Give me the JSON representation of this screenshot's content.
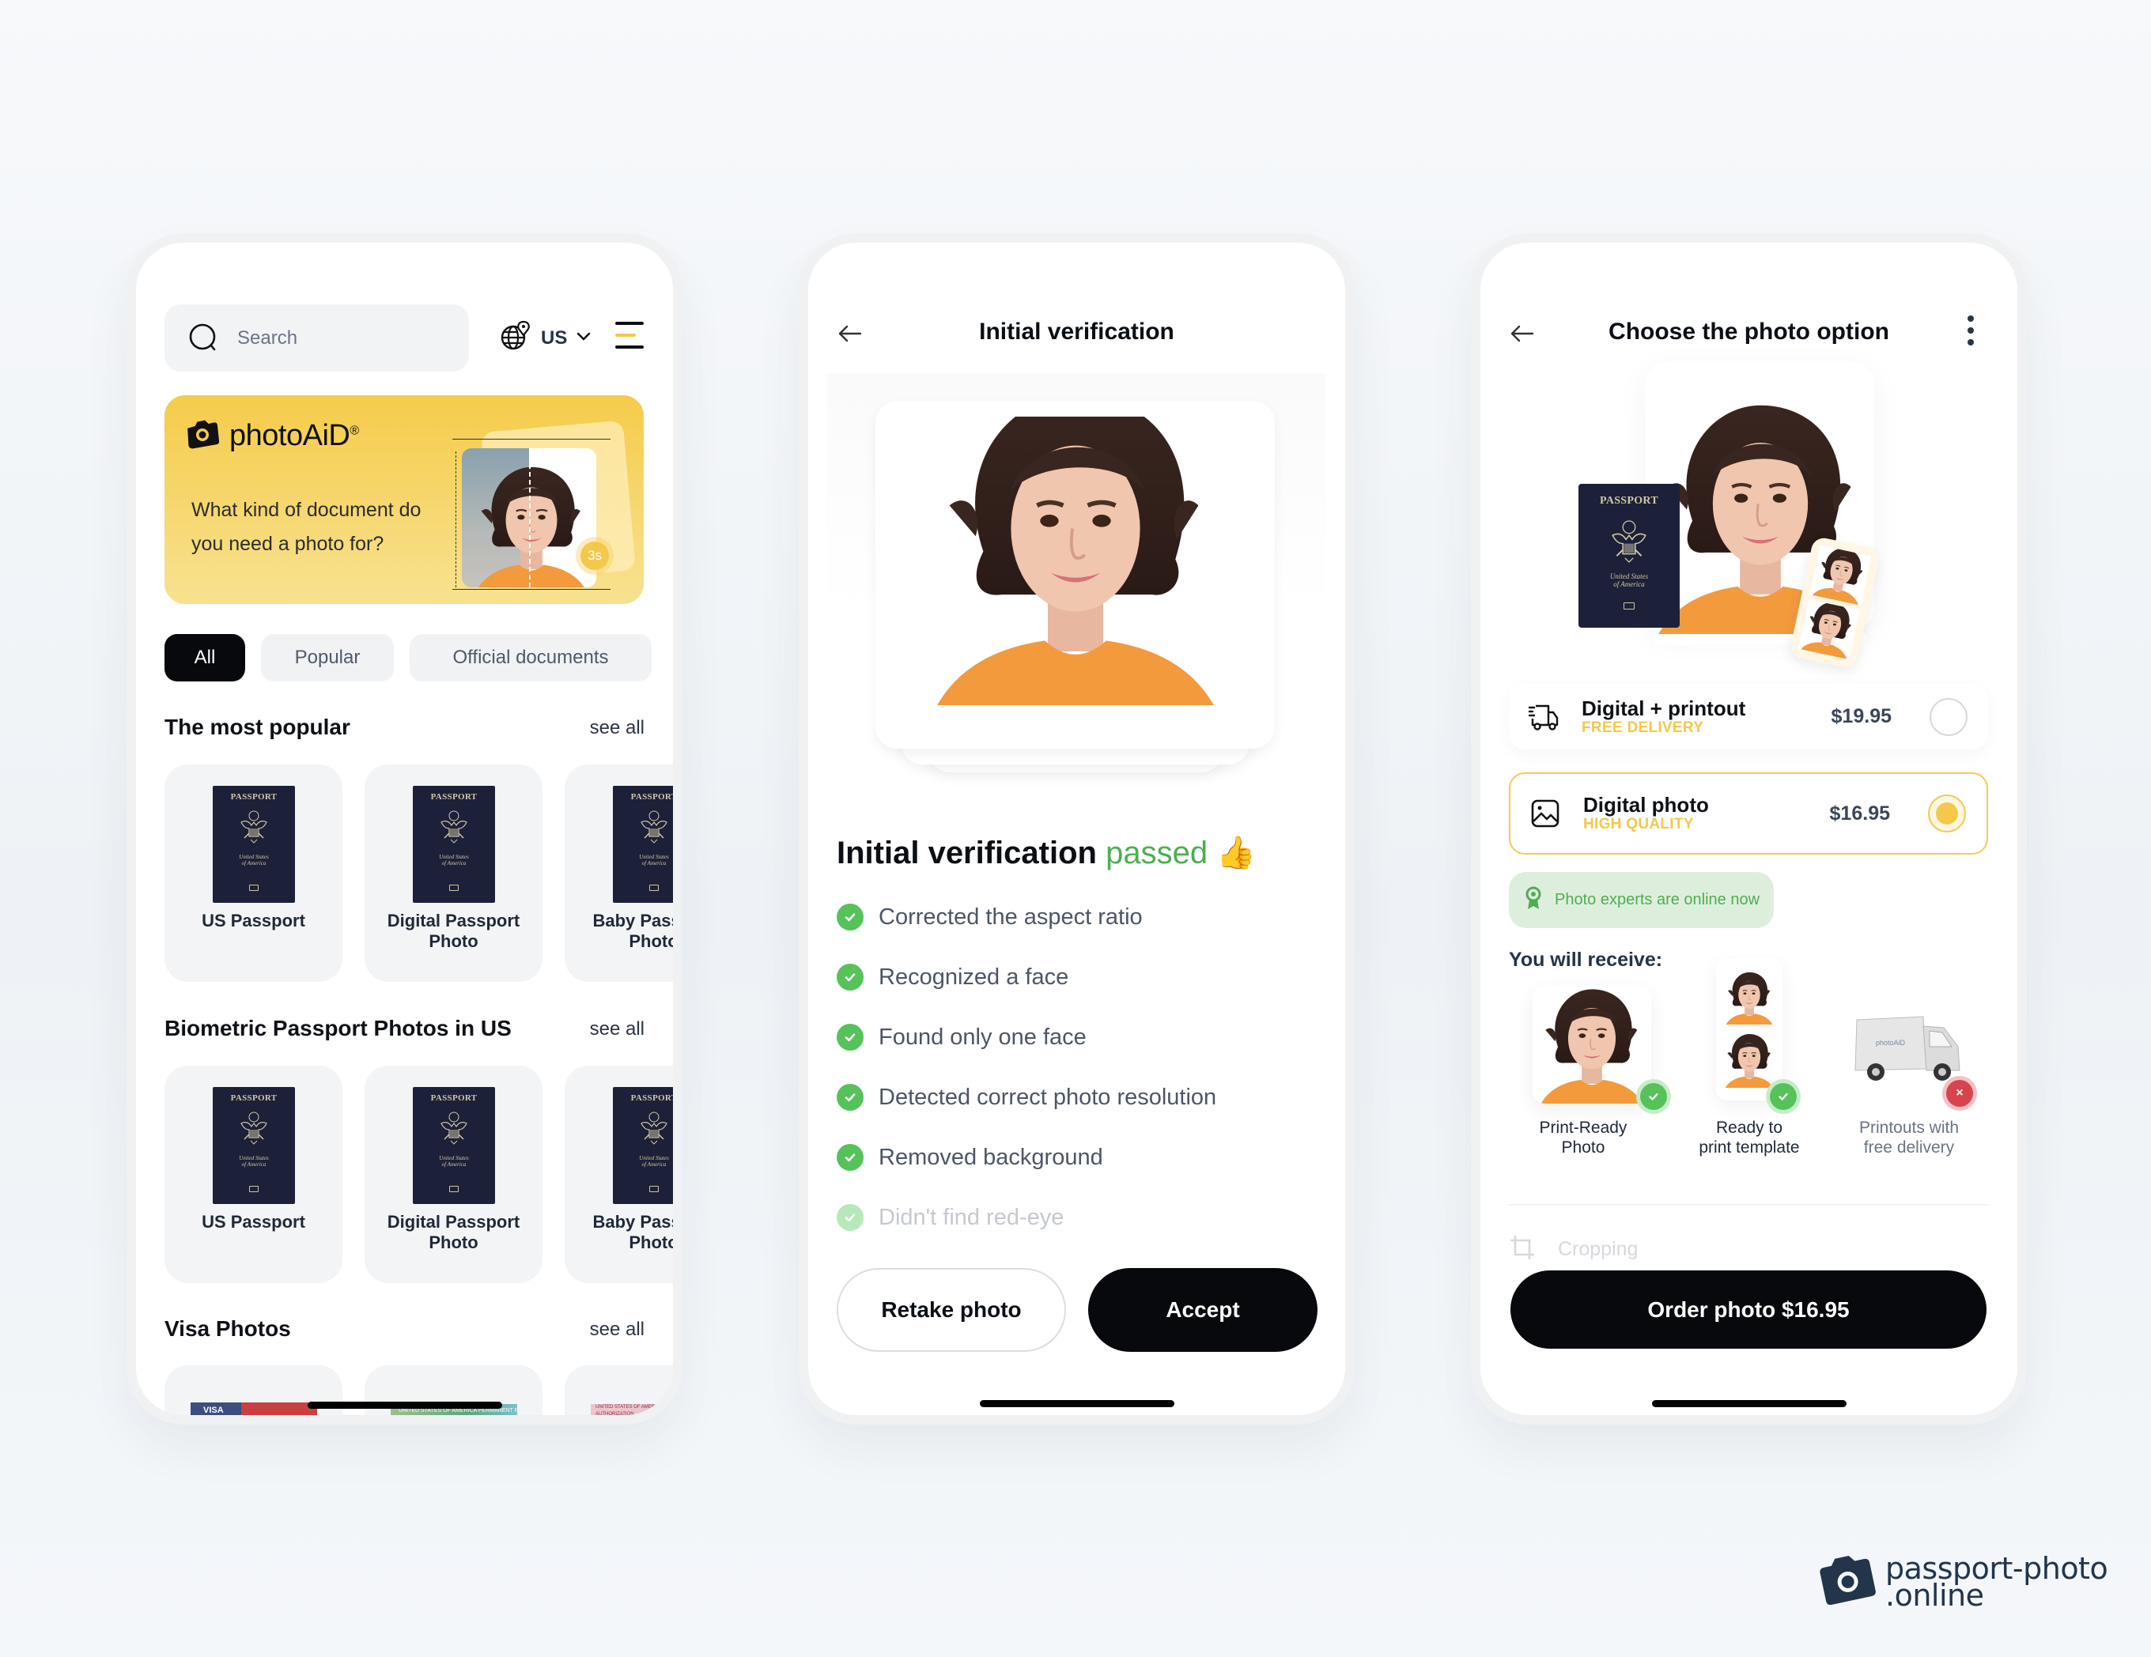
{
  "colors": {
    "accent_yellow": "#f4c84a",
    "success_green": "#4caf50",
    "check_green": "#56c25a",
    "error_red": "#d7444e",
    "primary_dark": "#07090c",
    "brand_navy": "#22354a"
  },
  "home_screen": {
    "search": {
      "placeholder": "Search",
      "value": ""
    },
    "locale": {
      "icon": "globe-pin-icon",
      "label": "US",
      "chevron": "chevron-down-icon"
    },
    "menu": {
      "icon": "hamburger-menu-icon"
    },
    "banner": {
      "brand": "photoAiD",
      "brand_mark": "®",
      "prompt": "What kind of document do you need a photo for?",
      "timer_badge": "3s"
    },
    "filter_chips": [
      {
        "label": "All",
        "active": true
      },
      {
        "label": "Popular",
        "active": false
      },
      {
        "label": "Official documents",
        "active": false
      }
    ],
    "sections": [
      {
        "title": "The most popular",
        "see_all": "see all",
        "cards": [
          {
            "name": "US Passport",
            "image": "us-passport-cover"
          },
          {
            "name": "Digital Passport Photo",
            "image": "us-passport-cover"
          },
          {
            "name": "Baby Passport Photo",
            "image": "us-passport-cover"
          }
        ]
      },
      {
        "title": "Biometric Passport Photos in US",
        "see_all": "see all",
        "cards": [
          {
            "name": "US Passport",
            "image": "us-passport-cover"
          },
          {
            "name": "Digital Passport Photo",
            "image": "us-passport-cover"
          },
          {
            "name": "Baby Passport Photo",
            "image": "us-passport-cover"
          }
        ]
      },
      {
        "title": "Visa Photos",
        "see_all": "see all",
        "cards": [
          {
            "name": "",
            "image": "us-visa",
            "image_text": "VISA"
          },
          {
            "name": "",
            "image": "permanent-resident-card",
            "image_text": "UNITED STATES OF AMERICA  PERMANENT RESIDENT"
          },
          {
            "name": "",
            "image": "employment-authorization-card",
            "image_text": "UNITED STATES OF AMERICA  EMPLOYMENT AUTHORIZATION"
          }
        ]
      }
    ],
    "passport_cover": {
      "title": "PASSPORT",
      "country_line1": "United States",
      "country_line2": "of America"
    }
  },
  "verification_screen": {
    "title": "Initial verification",
    "heading": {
      "prefix": "Initial verification",
      "status": "passed",
      "emoji": "👍"
    },
    "checks": [
      {
        "label": "Corrected the aspect ratio",
        "done": true
      },
      {
        "label": "Recognized a face",
        "done": true
      },
      {
        "label": "Found only one face",
        "done": true
      },
      {
        "label": "Detected correct photo resolution",
        "done": true
      },
      {
        "label": "Removed background",
        "done": true
      },
      {
        "label": "Didn't find red-eye",
        "done": true,
        "faded": true
      }
    ],
    "buttons": {
      "retake": "Retake photo",
      "accept": "Accept"
    }
  },
  "options_screen": {
    "title": "Choose the photo option",
    "hero_passport": {
      "title": "PASSPORT",
      "country_line1": "United States",
      "country_line2": "of America"
    },
    "options": [
      {
        "name": "Digital + printout",
        "sub": "FREE DELIVERY",
        "price": "$19.95",
        "icon": "delivery-truck-icon",
        "selected": false
      },
      {
        "name": "Digital photo",
        "sub": "HIGH QUALITY",
        "price": "$16.95",
        "icon": "image-icon",
        "selected": true
      }
    ],
    "experts_badge": "Photo experts are online now",
    "receive_title": "You will receive:",
    "receive_items": [
      {
        "label_line1": "Print-Ready",
        "label_line2": "Photo",
        "included": true
      },
      {
        "label_line1": "Ready to",
        "label_line2": "print template",
        "included": true
      },
      {
        "label_line1": "Printouts with",
        "label_line2": "free delivery",
        "included": false,
        "van_brand": "photoAiD"
      }
    ],
    "cropping_label": "Cropping",
    "order_button": "Order photo $16.95"
  },
  "site_logo": {
    "line1": "passport-photo",
    "line2": ".online"
  }
}
